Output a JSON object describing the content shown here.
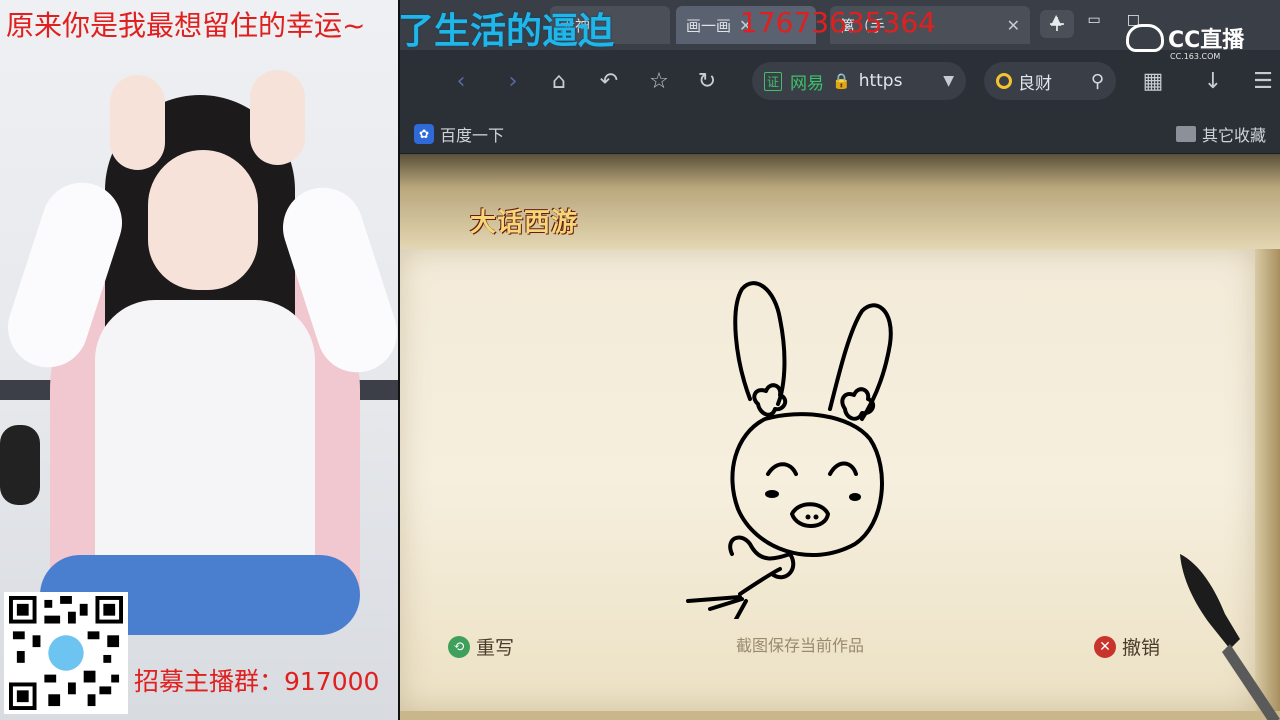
{
  "overlays": {
    "stream_title": "原来你是我最想留住的幸运~",
    "lyric": "了生活的逼迫",
    "phone": "17673635364",
    "recruit": "招募主播群：917000"
  },
  "cc_logo": {
    "name": "CC直播",
    "sub": "CC.163.COM"
  },
  "browser": {
    "tabs": [
      {
        "label": "大神",
        "active": false
      },
      {
        "label": "画一画",
        "active": true
      },
      {
        "label": "篱（手",
        "active": false
      }
    ],
    "new_tab_label": "+",
    "address": {
      "cert_label": "证",
      "site_name": "网易",
      "url": "https"
    },
    "search": {
      "engine_name": "良财"
    },
    "bookmarks": [
      {
        "label": "百度一下",
        "icon": "baidu-paw-icon"
      },
      {
        "label": "其它收藏",
        "icon": "folder-icon"
      }
    ]
  },
  "game": {
    "logo": "大话西游",
    "buttons": {
      "redraw": "重写",
      "save_hint": "截图保存当前作品",
      "undo": "撤销"
    }
  },
  "colors": {
    "overlay_red": "#e0201e",
    "lyric_blue": "#1fb6e8",
    "chrome_dark": "#2b2f36"
  }
}
